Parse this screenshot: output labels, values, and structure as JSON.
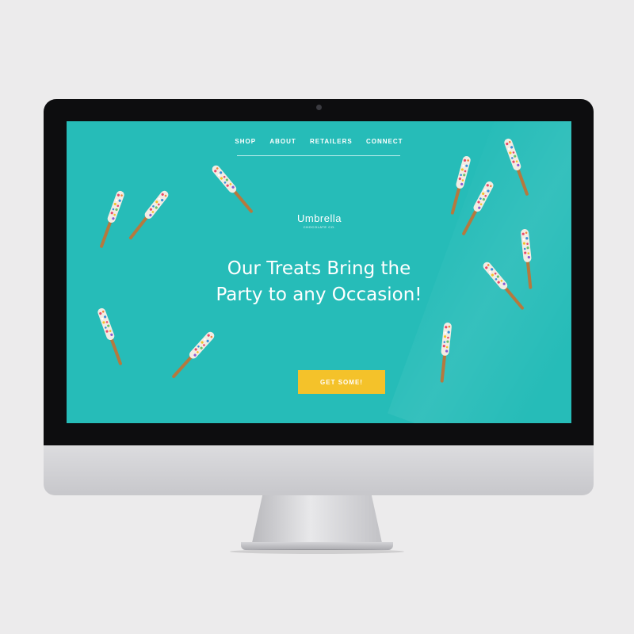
{
  "nav": {
    "items": [
      "SHOP",
      "ABOUT",
      "RETAILERS",
      "CONNECT"
    ]
  },
  "logo": {
    "brand": "Umbrella",
    "sub": "CHOCOLATE CO."
  },
  "hero": {
    "line1": "Our Treats Bring the",
    "line2": "Party to any Occasion!"
  },
  "cta": {
    "label": "GET SOME!"
  },
  "colors": {
    "screen_bg": "#26bcb8",
    "cta_bg": "#f4c22a",
    "text": "#ffffff",
    "pretzel": "#b5793e",
    "bezel": "#0d0d0f"
  },
  "decor": {
    "icon": "chocolate-pretzel-stick-icon",
    "count": 14
  }
}
